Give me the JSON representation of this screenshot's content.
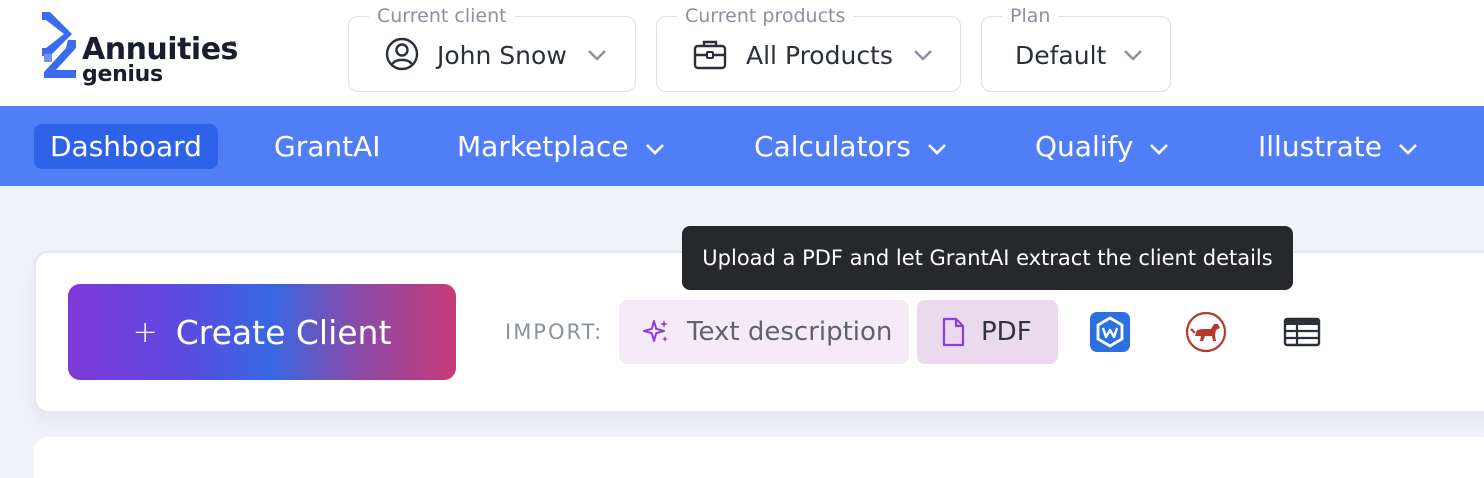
{
  "brand": {
    "name_line1": "Annuities",
    "trademark": "™",
    "name_line2": "genius"
  },
  "selectors": {
    "client": {
      "legend": "Current client",
      "value": "John Snow",
      "icon": "user-circle-icon"
    },
    "products": {
      "legend": "Current products",
      "value": "All Products",
      "icon": "briefcase-icon"
    },
    "plan": {
      "legend": "Plan",
      "value": "Default"
    }
  },
  "nav": {
    "items": [
      {
        "label": "Dashboard",
        "active": true
      },
      {
        "label": "GrantAI"
      },
      {
        "label": "Marketplace",
        "dropdown": true
      },
      {
        "label": "Calculators",
        "dropdown": true
      },
      {
        "label": "Qualify",
        "dropdown": true
      },
      {
        "label": "Illustrate",
        "dropdown": true
      }
    ]
  },
  "actions": {
    "create_plus": "+",
    "create_label": "Create Client",
    "import_label": "IMPORT:",
    "text_description": "Text description",
    "pdf": "PDF"
  },
  "tooltip": "Upload a PDF and let GrantAI extract the client details",
  "colors": {
    "nav_bg": "#4f7ef7",
    "nav_active": "#2e62e8",
    "logo_blue": "#3b6cf0",
    "tooltip_bg": "#26282c",
    "purple_accent": "#8b3fd6",
    "red_accent": "#b8382e"
  }
}
